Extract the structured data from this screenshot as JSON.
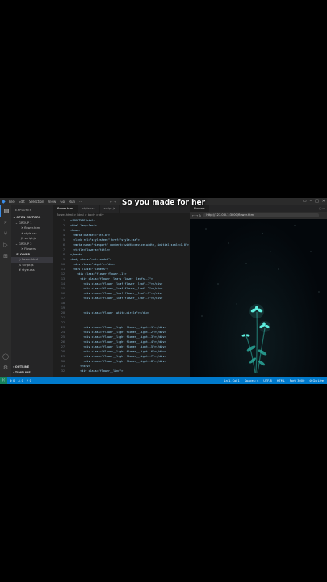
{
  "titlebar": {
    "menu": [
      "File",
      "Edit",
      "Selection",
      "View",
      "Go",
      "Run",
      "···"
    ],
    "nav_arrows": "← →"
  },
  "sidebar": {
    "header": "EXPLORER",
    "open_editors": "OPEN EDITORS",
    "group1": "GROUP 1",
    "group1_files": [
      "flower.html",
      "style.css",
      "script.js"
    ],
    "group2": "GROUP 2",
    "group2_files": [
      "Flowers"
    ],
    "folder": "FLOWER",
    "folder_files": [
      "flower.html",
      "script.js",
      "style.css"
    ],
    "outline": "OUTLINE",
    "timeline": "TIMELINE"
  },
  "editor": {
    "tabs": [
      "flower.html",
      "style.css",
      "script.js"
    ],
    "breadcrumb": "flower.html > html > body > div",
    "lines": [
      {
        "n": "1",
        "t": "<!DOCTYPE html>"
      },
      {
        "n": "2",
        "t": "<html lang=\"en\">"
      },
      {
        "n": "3",
        "t": "<head>"
      },
      {
        "n": "4",
        "t": "  <meta charset=\"utf-8\">"
      },
      {
        "n": "5",
        "t": "  <link rel=\"stylesheet\" href=\"style.css\">"
      },
      {
        "n": "6",
        "t": "  <meta name=\"viewport\" content=\"width=device-width, initial-scale=1.0\">"
      },
      {
        "n": "7",
        "t": "  <title>Flowers</title>"
      },
      {
        "n": "8",
        "t": "</head>"
      },
      {
        "n": "9",
        "t": "<body class=\"not-loaded\">"
      },
      {
        "n": "10",
        "t": "  <div class=\"night\"></div>"
      },
      {
        "n": "11",
        "t": "  <div class=\"flowers\">"
      },
      {
        "n": "12",
        "t": "    <div class=\"flower flower--1\">"
      },
      {
        "n": "13",
        "t": "      <div class=\"flower__leafs flower__leafs--1\">"
      },
      {
        "n": "14",
        "t": "        <div class=\"flower__leaf flower__leaf--1\"></div>"
      },
      {
        "n": "15",
        "t": "        <div class=\"flower__leaf flower__leaf--2\"></div>"
      },
      {
        "n": "16",
        "t": "        <div class=\"flower__leaf flower__leaf--3\"></div>"
      },
      {
        "n": "17",
        "t": "        <div class=\"flower__leaf flower__leaf--4\"></div>"
      },
      {
        "n": "18",
        "t": ""
      },
      {
        "n": "19",
        "t": ""
      },
      {
        "n": "20",
        "t": "        <div class=\"flower__white-circle\"></div>"
      },
      {
        "n": "21",
        "t": ""
      },
      {
        "n": "22",
        "t": ""
      },
      {
        "n": "23",
        "t": "        <div class=\"flower__light flower__light--1\"></div>"
      },
      {
        "n": "24",
        "t": "        <div class=\"flower__light flower__light--2\"></div>"
      },
      {
        "n": "25",
        "t": "        <div class=\"flower__light flower__light--3\"></div>"
      },
      {
        "n": "26",
        "t": "        <div class=\"flower__light flower__light--4\"></div>"
      },
      {
        "n": "27",
        "t": "        <div class=\"flower__light flower__light--5\"></div>"
      },
      {
        "n": "28",
        "t": "        <div class=\"flower__light flower__light--6\"></div>"
      },
      {
        "n": "29",
        "t": "        <div class=\"flower__light flower__light--7\"></div>"
      },
      {
        "n": "30",
        "t": "        <div class=\"flower__light flower__light--8\"></div>"
      },
      {
        "n": "31",
        "t": "      </div>"
      },
      {
        "n": "32",
        "t": "      <div class=\"flower__line\">"
      }
    ]
  },
  "browser": {
    "tab": "Flowers",
    "url": "http://127.0.0.1:3000/flower.html"
  },
  "status": {
    "left": [
      "⊗ 0",
      "⚠ 0",
      "⚡ 0"
    ],
    "right": [
      "Ln 1, Col 1",
      "Spaces: 4",
      "UTF-8",
      "HTML",
      "Port: 3000",
      "⊘ Go Live"
    ]
  },
  "caption": "So you made for her",
  "colors": {
    "accent": "#007acc",
    "flower": "#5ff0e0"
  }
}
